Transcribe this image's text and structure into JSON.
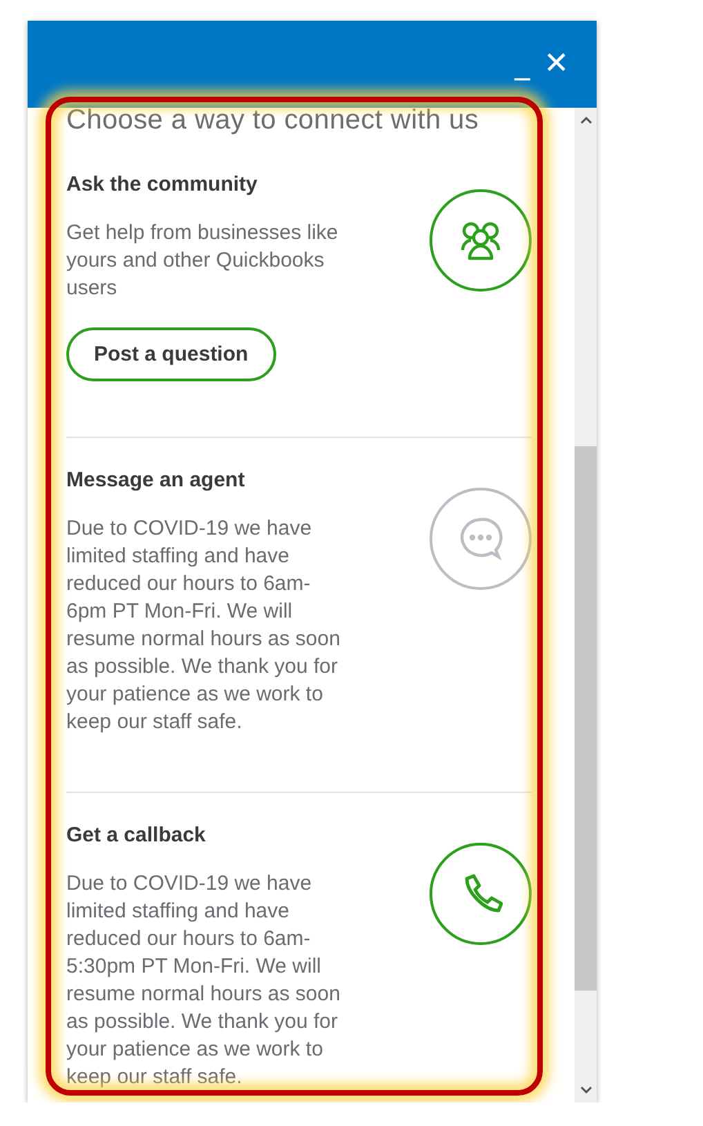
{
  "window": {
    "minimize": "_",
    "close": "✕"
  },
  "heading": "Choose a way to connect with us",
  "sections": [
    {
      "kind": "community",
      "available": true,
      "title": "Ask the community",
      "text": "Get help from businesses like yours and other Quickbooks users",
      "button": "Post a question"
    },
    {
      "kind": "chat",
      "available": false,
      "title": "Message an agent",
      "text": "Due to COVID-19 we have limited staffing and have reduced our hours to 6am-6pm PT Mon-Fri. We will resume normal hours as soon as possible. We thank you for your patience as we work to keep our staff safe."
    },
    {
      "kind": "callback",
      "available": true,
      "title": "Get a callback",
      "text": "Due to COVID-19 we have limited staffing and have reduced our hours to 6am-5:30pm PT Mon-Fri. We will resume normal hours as soon as possible. We thank you for your patience as we work to keep our staff safe."
    }
  ],
  "highlight": {
    "on": true
  }
}
